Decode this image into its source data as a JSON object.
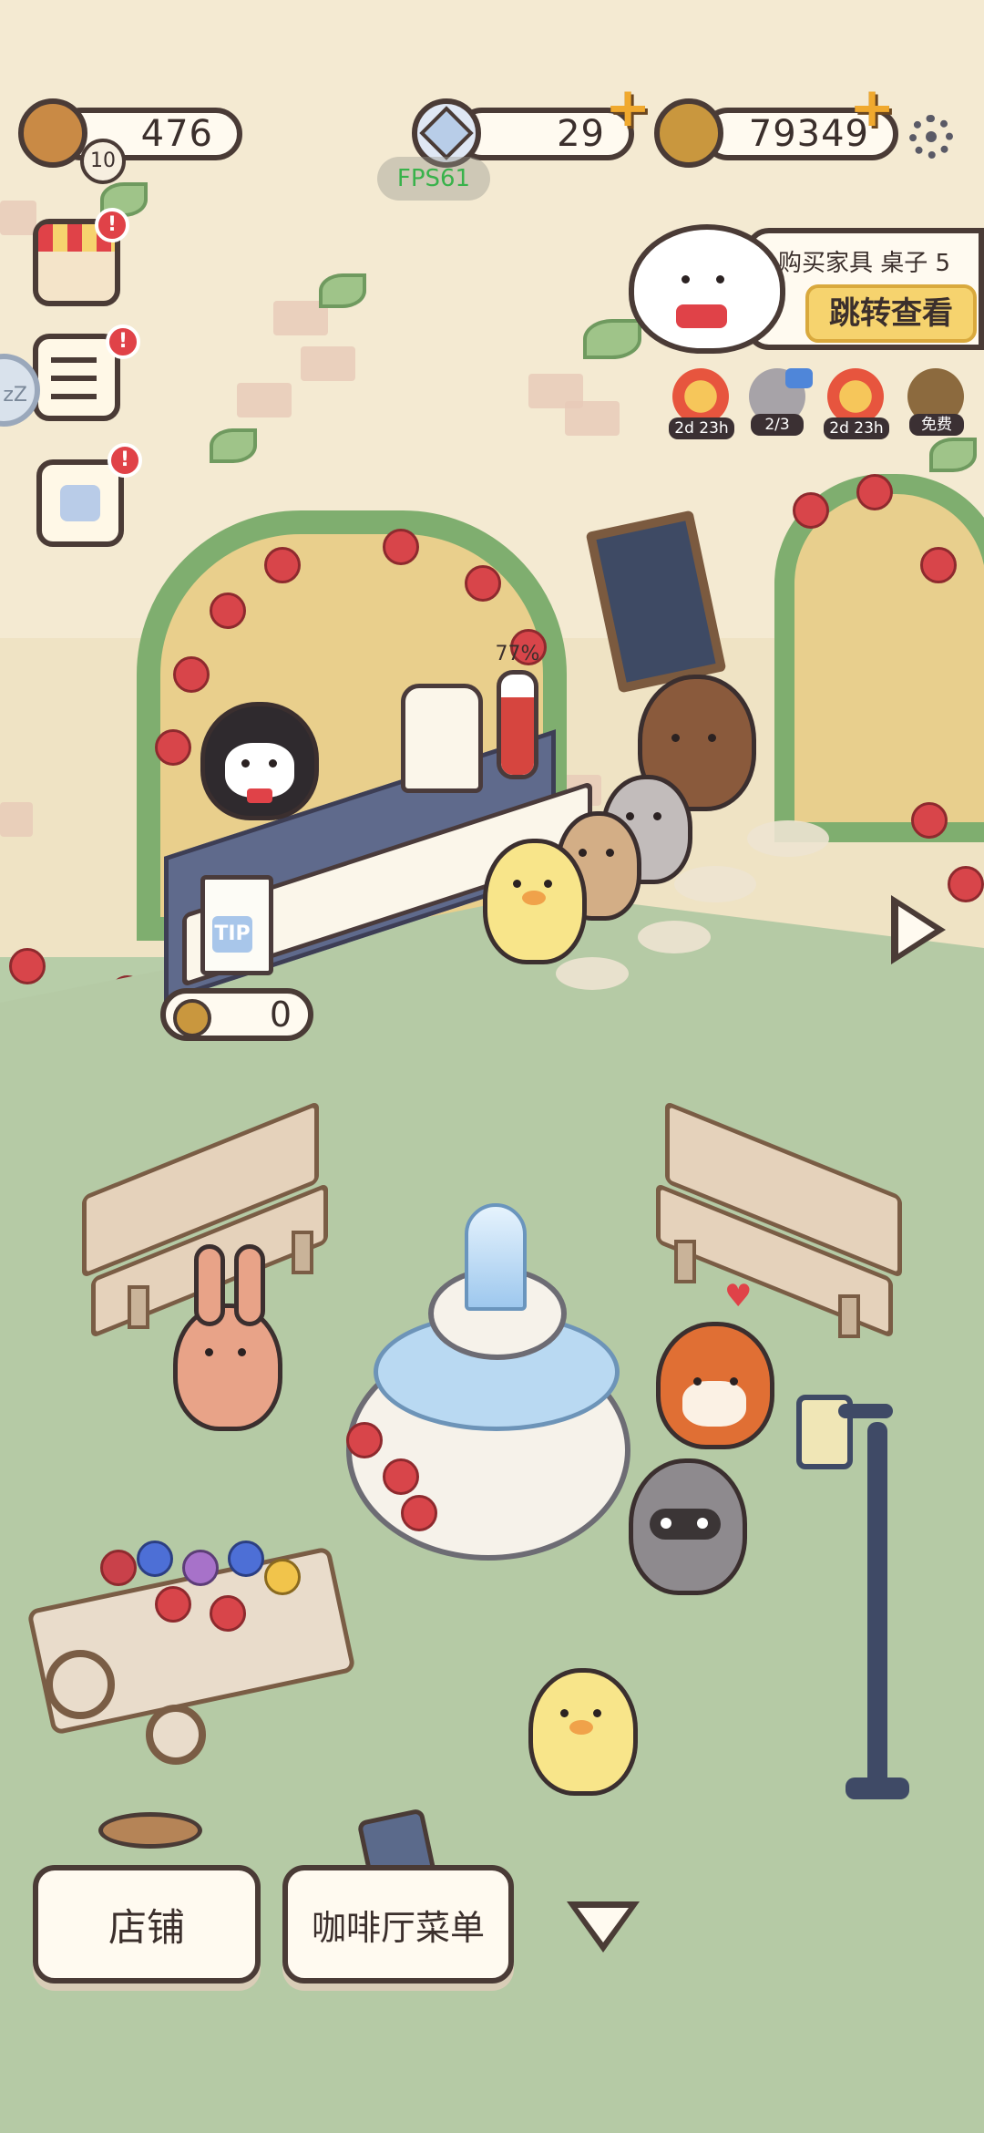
{
  "hud": {
    "energy": {
      "value": "476",
      "level": "10"
    },
    "diamonds": {
      "value": "29"
    },
    "coins": {
      "value": "79349"
    },
    "fps": "FPS61"
  },
  "quest": {
    "title": "购买家具  桌子  5",
    "button": "跳转查看"
  },
  "buffs": [
    {
      "icon": "fire-coin-icon",
      "label": "2d 23h"
    },
    {
      "icon": "video-boost-icon",
      "label": "2/3"
    },
    {
      "icon": "fire-coins-icon",
      "label": "2d 23h"
    },
    {
      "icon": "free-boost-icon",
      "label": "免费"
    }
  ],
  "sidebar": {
    "items": [
      {
        "name": "shop-stall",
        "badge": "!"
      },
      {
        "name": "task-list",
        "badge": "!"
      },
      {
        "name": "calendar",
        "badge": "!"
      },
      {
        "name": "sleep",
        "label": "zZ"
      }
    ]
  },
  "scene": {
    "counter_progress": "77%",
    "milk_label": "TIP",
    "tip_tray_value": "0"
  },
  "bottom_bar": {
    "store_label": "店铺",
    "menu_label": "咖啡厅菜单"
  },
  "colors": {
    "wall": "#f4ead2",
    "grass": "#b5caa5",
    "outline": "#4a3b36",
    "accent_gold": "#f0a92e",
    "badge_red": "#e04248"
  }
}
